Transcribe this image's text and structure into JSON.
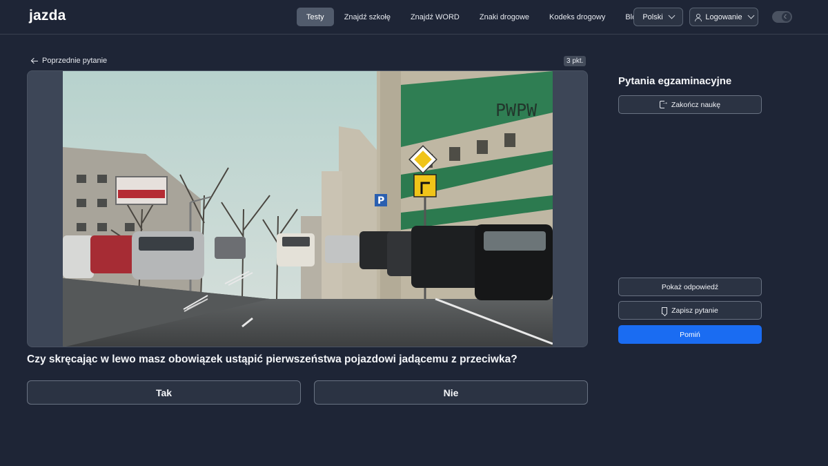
{
  "header": {
    "logo": "jazda",
    "nav": [
      {
        "label": "Testy",
        "active": true
      },
      {
        "label": "Znajdź szkołę",
        "active": false
      },
      {
        "label": "Znajdź WORD",
        "active": false
      },
      {
        "label": "Znaki drogowe",
        "active": false
      },
      {
        "label": "Kodeks drogowy",
        "active": false
      },
      {
        "label": "Blog",
        "active": false
      }
    ],
    "language_label": "Polski",
    "login_label": "Logowanie",
    "theme_icon": "moon-icon"
  },
  "main": {
    "back_label": "Poprzednie pytanie",
    "points": "3 pkt.",
    "media_watermark": "PWPW",
    "question": "Czy skręcając w lewo masz obowiązek ustąpić pierwszeństwa pojazdowi jadącemu z przeciwka?",
    "answers": [
      "Tak",
      "Nie"
    ]
  },
  "sidebar": {
    "title": "Pytania egzaminacyjne",
    "end_label": "Zakończ naukę",
    "show_answer_label": "Pokaż odpowiedź",
    "save_label": "Zapisz pytanie",
    "skip_label": "Pomiń"
  },
  "colors": {
    "background": "#1e2536",
    "accent": "#1a6cf2"
  }
}
